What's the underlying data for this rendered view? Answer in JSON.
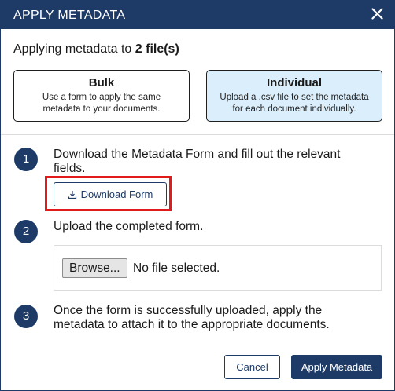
{
  "dialog": {
    "title": "APPLY METADATA",
    "close_icon": "close-icon",
    "applying_prefix": "Applying metadata to ",
    "applying_count": "2 file(s)"
  },
  "modes": [
    {
      "title": "Bulk",
      "description": "Use a form to apply the same metadata to your documents.",
      "selected": false
    },
    {
      "title": "Individual",
      "description": "Upload a .csv file to set the metadata for each document individually.",
      "selected": true
    }
  ],
  "steps": [
    {
      "number": "1",
      "text": "Download the Metadata Form and fill out the relevant fields."
    },
    {
      "number": "2",
      "text": "Upload the completed form."
    },
    {
      "number": "3",
      "text": "Once the form is successfully uploaded, apply the metadata to attach it to the appropriate documents."
    }
  ],
  "download_button": {
    "label": "Download Form",
    "icon": "download-icon"
  },
  "file_input": {
    "button_label": "Browse...",
    "status": "No file selected."
  },
  "footer": {
    "cancel_label": "Cancel",
    "apply_label": "Apply Metadata"
  },
  "colors": {
    "primary": "#1e3a66",
    "selected_bg": "#dbeefb",
    "highlight": "#e11b1b"
  }
}
